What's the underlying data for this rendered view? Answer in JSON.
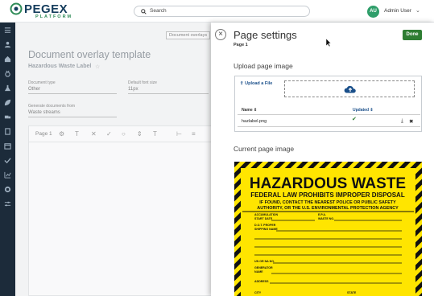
{
  "app": {
    "logo_main": "PEGEX",
    "logo_sub": "PLATFORM",
    "search_placeholder": "Search",
    "user_initials": "AU",
    "user_name": "Admin User"
  },
  "colors": {
    "brand": "#143c5c",
    "accent_green": "#2e7d32",
    "sidebar_bg": "#1c2b3a",
    "warning_yellow": "#ffe500"
  },
  "sidebar": {
    "icons": [
      "menu-icon",
      "home-icon",
      "people-icon",
      "medal-icon",
      "flask-icon",
      "leaf-icon",
      "truck-icon",
      "document-icon",
      "calendar-icon",
      "check-icon",
      "chart-icon",
      "settings-icon",
      "sliders-icon"
    ]
  },
  "background": {
    "breadcrumb": "Document overlays",
    "doc_title": "Document overlay template",
    "doc_subtitle": "Hazardous Waste Label",
    "doc_type_label": "Document type",
    "doc_type_value": "Other",
    "font_size_label": "Default font size",
    "font_size_value": "11px",
    "generate_label": "Generate documents from",
    "generate_value": "Waste streams",
    "page_label": "Page 1"
  },
  "overlay": {
    "title": "Page settings",
    "subtitle": "Page 1",
    "done_label": "Done",
    "upload_section": "Upload page image",
    "upload_link": "Upload a File",
    "col_name": "Name",
    "col_updated": "Updated",
    "file_name": "hazlabel.png",
    "current_section": "Current page image"
  },
  "label_image": {
    "heading": "HAZARDOUS WASTE",
    "law": "FEDERAL LAW PROHIBITS IMPROPER DISPOSAL",
    "contact1": "IF FOUND, CONTACT THE NEAREST POLICE OR PUBLIC SAFETY",
    "contact2": "AUTHORITY, OR THE U.S. ENVIRONMENTAL PROTECTION AGENCY",
    "accum": "ACCUMULATION",
    "start_date": "START DATE",
    "epa": "E.P.A.",
    "waste_no": "WASTE NO.",
    "dot1": "D.O.T. PROPER",
    "dot2": "SHIPPING NAME",
    "un_na": "UN OR NA NO.",
    "gen1": "GENERATOR",
    "gen2": "NAME",
    "address": "ADDRESS",
    "city": "CITY",
    "state": "STATE"
  }
}
